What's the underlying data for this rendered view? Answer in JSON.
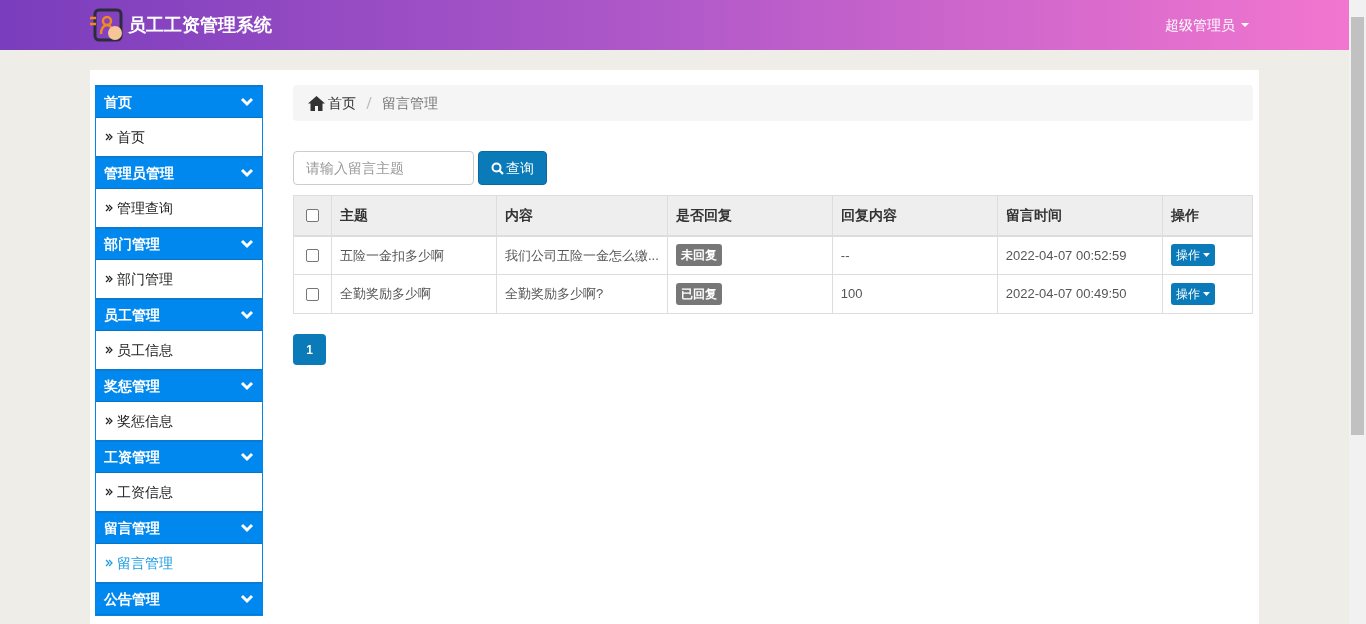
{
  "header": {
    "title": "员工工资管理系统",
    "user": "超级管理员"
  },
  "sidebar": {
    "groups": [
      {
        "label": "首页",
        "items": [
          {
            "label": "首页",
            "selected": false
          }
        ]
      },
      {
        "label": "管理员管理",
        "items": [
          {
            "label": "管理查询",
            "selected": false
          }
        ]
      },
      {
        "label": "部门管理",
        "items": [
          {
            "label": "部门管理",
            "selected": false
          }
        ]
      },
      {
        "label": "员工管理",
        "items": [
          {
            "label": "员工信息",
            "selected": false
          }
        ]
      },
      {
        "label": "奖惩管理",
        "items": [
          {
            "label": "奖惩信息",
            "selected": false
          }
        ]
      },
      {
        "label": "工资管理",
        "items": [
          {
            "label": "工资信息",
            "selected": false
          }
        ]
      },
      {
        "label": "留言管理",
        "items": [
          {
            "label": "留言管理",
            "selected": true
          }
        ]
      },
      {
        "label": "公告管理"
      }
    ]
  },
  "breadcrumb": [
    "首页",
    "留言管理"
  ],
  "search": {
    "placeholder": "请输入留言主题",
    "button": "查询"
  },
  "table": {
    "select_all_checked": false,
    "columns": [
      "主题",
      "内容",
      "是否回复",
      "回复内容",
      "留言时间",
      "操作"
    ],
    "rows": [
      {
        "checked": false,
        "subject": "五险一金扣多少啊",
        "content": "我们公司五险一金怎么缴...",
        "status": "未回复",
        "reply": "--",
        "time": "2022-04-07 00:52:59",
        "action": "操作"
      },
      {
        "checked": false,
        "subject": "全勤奖励多少啊",
        "content": "全勤奖励多少啊?",
        "status": "已回复",
        "reply": "100",
        "time": "2022-04-07 00:49:50",
        "action": "操作"
      }
    ]
  },
  "pagination": [
    {
      "label": "1",
      "selected": true
    }
  ]
}
